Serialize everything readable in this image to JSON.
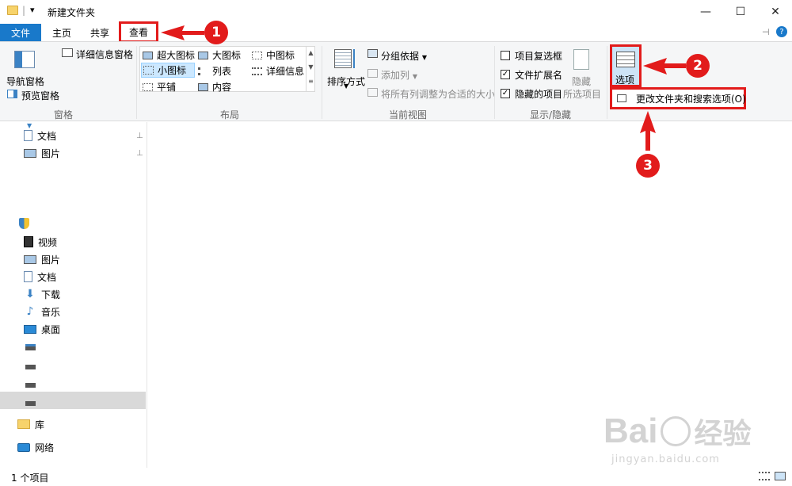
{
  "window": {
    "title": "新建文件夹",
    "qat_sep": "|",
    "qat_arrow": "▾",
    "minimize": "—",
    "maximize": "☐",
    "close": "✕"
  },
  "tabs": {
    "file": "文件",
    "home": "主页",
    "share": "共享",
    "view": "查看"
  },
  "ribbon": {
    "pane": {
      "nav_pane": "导航窗格",
      "preview_pane": "预览窗格",
      "details_pane": "详细信息窗格",
      "group": "窗格"
    },
    "layout": {
      "items": [
        "超大图标",
        "大图标",
        "中图标",
        "小图标",
        "列表",
        "详细信息",
        "平铺",
        "内容"
      ],
      "group": "布局"
    },
    "current_view": {
      "sort_by": "排序方式",
      "group_by": "分组依据",
      "add_column": "添加列",
      "size_all_columns": "将所有列调整为合适的大小",
      "group": "当前视图"
    },
    "show_hide": {
      "item_checkboxes": "项目复选框",
      "file_extensions": "文件扩展名",
      "hidden_items": "隐藏的项目",
      "hide_selected_line1": "隐藏",
      "hide_selected_line2": "所选项目",
      "group": "显示/隐藏"
    },
    "options": {
      "label": "选项",
      "dropdown_item": "更改文件夹和搜索选项(O)"
    }
  },
  "nav": {
    "quick_items": [
      "文档",
      "图片"
    ],
    "pc_items": [
      "视频",
      "图片",
      "文档",
      "下载",
      "音乐",
      "桌面"
    ],
    "library": "库",
    "network": "网络"
  },
  "status": {
    "count": "1 个项目"
  },
  "annotations": {
    "one": "1",
    "two": "2",
    "three": "3"
  },
  "watermark": {
    "brand": "Bai",
    "brand_cn": "经验",
    "url": "jingyan.baidu.com"
  },
  "colors": {
    "accent": "#1979ca",
    "annotation_red": "#e21b1b",
    "selection": "#cce8ff"
  }
}
